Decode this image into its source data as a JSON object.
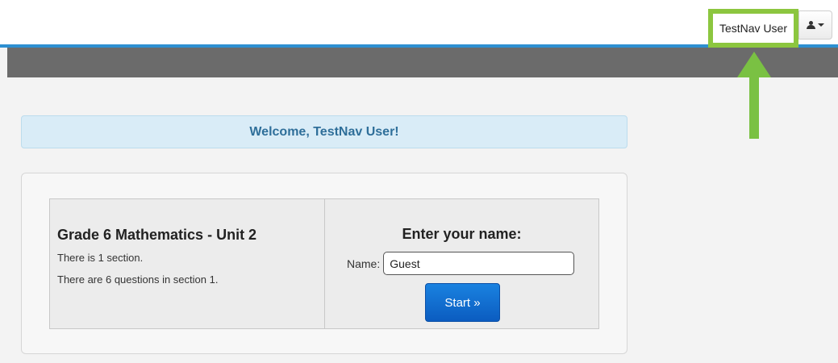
{
  "header": {
    "user_name": "TestNav User",
    "user_menu_icon": "person-icon",
    "highlight_color": "#8cc63f",
    "accent_color": "#2d8fd1"
  },
  "welcome": {
    "message": "Welcome, TestNav User!"
  },
  "test": {
    "title": "Grade 6 Mathematics - Unit 2",
    "sections_text": "There is 1 section.",
    "questions_text": "There are 6 questions in section 1."
  },
  "name_form": {
    "heading": "Enter your name:",
    "label": "Name:",
    "value": "Guest",
    "start_label": "Start »",
    "start_color": "#1373d6"
  }
}
